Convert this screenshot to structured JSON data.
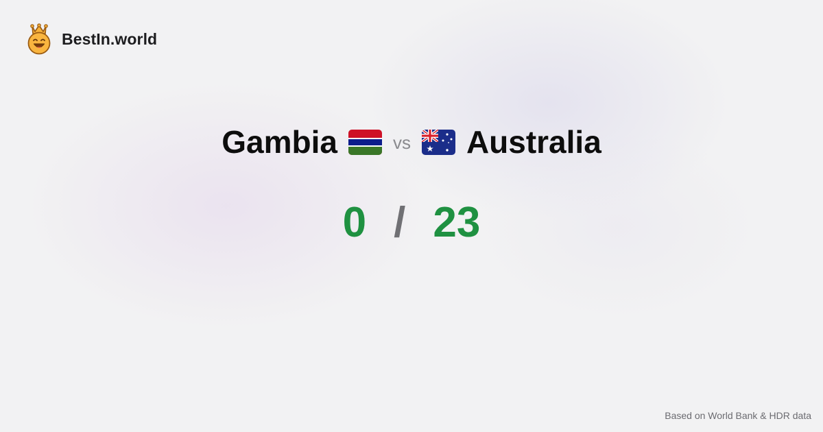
{
  "brand": {
    "name": "BestIn.world",
    "logo_icon": "crowned-smiley-icon"
  },
  "comparison": {
    "left_country": "Gambia",
    "left_flag": "gambia-flag-icon",
    "vs_label": "vs",
    "right_country": "Australia",
    "right_flag": "australia-flag-icon",
    "left_score": "0",
    "separator": "/",
    "right_score": "23"
  },
  "footer": {
    "source_note": "Based on World Bank & HDR data"
  },
  "colors": {
    "background": "#f2f2f3",
    "score_green": "#1f9141",
    "title_text": "#0d0d0d",
    "muted_text": "#8a8a8e"
  }
}
